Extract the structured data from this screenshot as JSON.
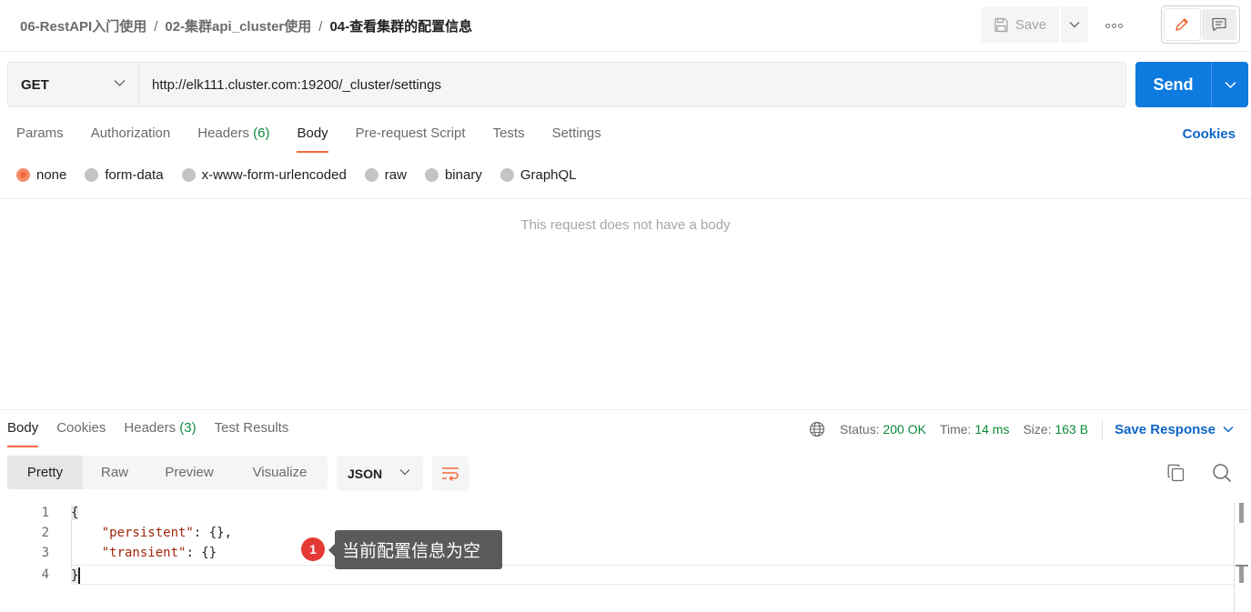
{
  "breadcrumb": {
    "items": [
      "06-RestAPI入门使用",
      "02-集群api_cluster使用"
    ],
    "current": "04-查看集群的配置信息",
    "separator": "/"
  },
  "toolbar": {
    "save_label": "Save",
    "save_icon": "floppy-disk-icon",
    "more_icon": "ellipsis-icon",
    "mode_icons": [
      "pencil-icon",
      "comment-icon"
    ]
  },
  "request": {
    "method": "GET",
    "url": "http://elk111.cluster.com:19200/_cluster/settings",
    "send_label": "Send"
  },
  "request_tabs": {
    "params": "Params",
    "authorization": "Authorization",
    "headers": "Headers",
    "headers_count": "(6)",
    "body": "Body",
    "prerequest": "Pre-request Script",
    "tests": "Tests",
    "settings": "Settings",
    "active": "Body",
    "cookies_link": "Cookies"
  },
  "body_types": {
    "options": [
      "none",
      "form-data",
      "x-www-form-urlencoded",
      "raw",
      "binary",
      "GraphQL"
    ],
    "selected": "none",
    "empty_message": "This request does not have a body"
  },
  "response_tabs": {
    "body": "Body",
    "cookies": "Cookies",
    "headers": "Headers",
    "headers_count": "(3)",
    "test_results": "Test Results",
    "active": "Body"
  },
  "response_meta": {
    "status_label": "Status:",
    "status_value": "200 OK",
    "time_label": "Time:",
    "time_value": "14 ms",
    "size_label": "Size:",
    "size_value": "163 B",
    "save_response": "Save Response"
  },
  "view_modes": {
    "pretty": "Pretty",
    "raw": "Raw",
    "preview": "Preview",
    "visualize": "Visualize",
    "active": "Pretty",
    "format": "JSON"
  },
  "code": {
    "line_numbers": [
      "1",
      "2",
      "3",
      "4"
    ],
    "line1": "{",
    "line2_key": "\"persistent\"",
    "line2_rest": ": {},",
    "line3_key": "\"transient\"",
    "line3_rest": ": {}",
    "line4": "}"
  },
  "annotation": {
    "badge": "1",
    "text": "当前配置信息为空"
  },
  "colors": {
    "accent": "#f26b3a",
    "send": "#0d7ae0",
    "link": "#0d65c6",
    "success": "#0c8a3a",
    "json_key": "#a1260d"
  }
}
